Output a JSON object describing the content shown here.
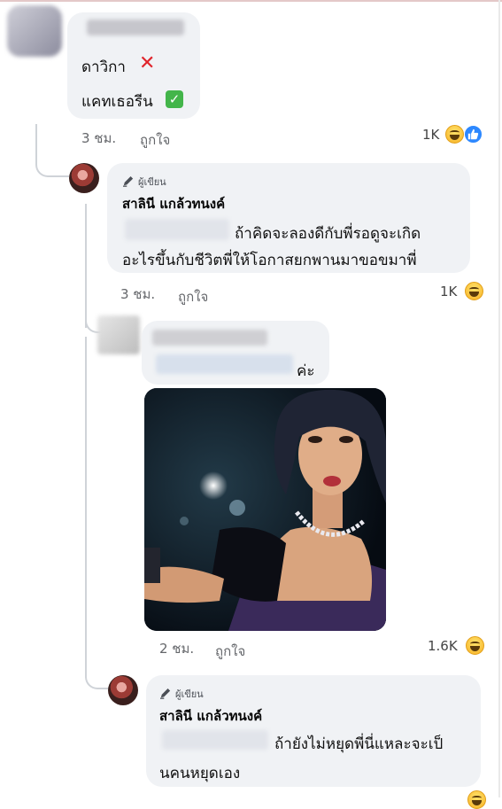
{
  "comment1": {
    "line1": "ดาวิกา",
    "line2": "แคทเธอรีน",
    "time": "3 ชม.",
    "like_label": "ถูกใจ",
    "reaction_count": "1K",
    "reactions": [
      "haha-emoji-icon",
      "like-emoji-icon"
    ]
  },
  "reply1": {
    "author_tag": "ผู้เขียน",
    "author_name": "สาลินี แกล้วทนงค์",
    "text_line1": "ถ้าคิดจะลองดีกับพี่รอดูจะเกิด",
    "text_line2": "อะไรขึ้นกับชีวิตพี่ให้โอกาสยกพานมาขอขมาพี่",
    "time": "3 ชม.",
    "like_label": "ถูกใจ",
    "reaction_count": "1K",
    "reactions": [
      "haha-emoji-icon"
    ]
  },
  "reply2": {
    "text_suffix": "ค่ะ",
    "time": "2 ชม.",
    "like_label": "ถูกใจ",
    "reaction_count": "1.6K",
    "reactions": [
      "haha-emoji-icon"
    ]
  },
  "reply3": {
    "author_tag": "ผู้เขียน",
    "author_name": "สาลินี แกล้วทนงค์",
    "text_line1": "ถ้ายังไม่หยุดพี่นี่แหละจะเป็",
    "text_line2": "นคนหยุดเอง"
  },
  "colors": {
    "bubble": "#f0f2f5",
    "meta_text": "#65676b",
    "like_blue": "#2d88ff",
    "haha_yellow": "#f7b125"
  }
}
